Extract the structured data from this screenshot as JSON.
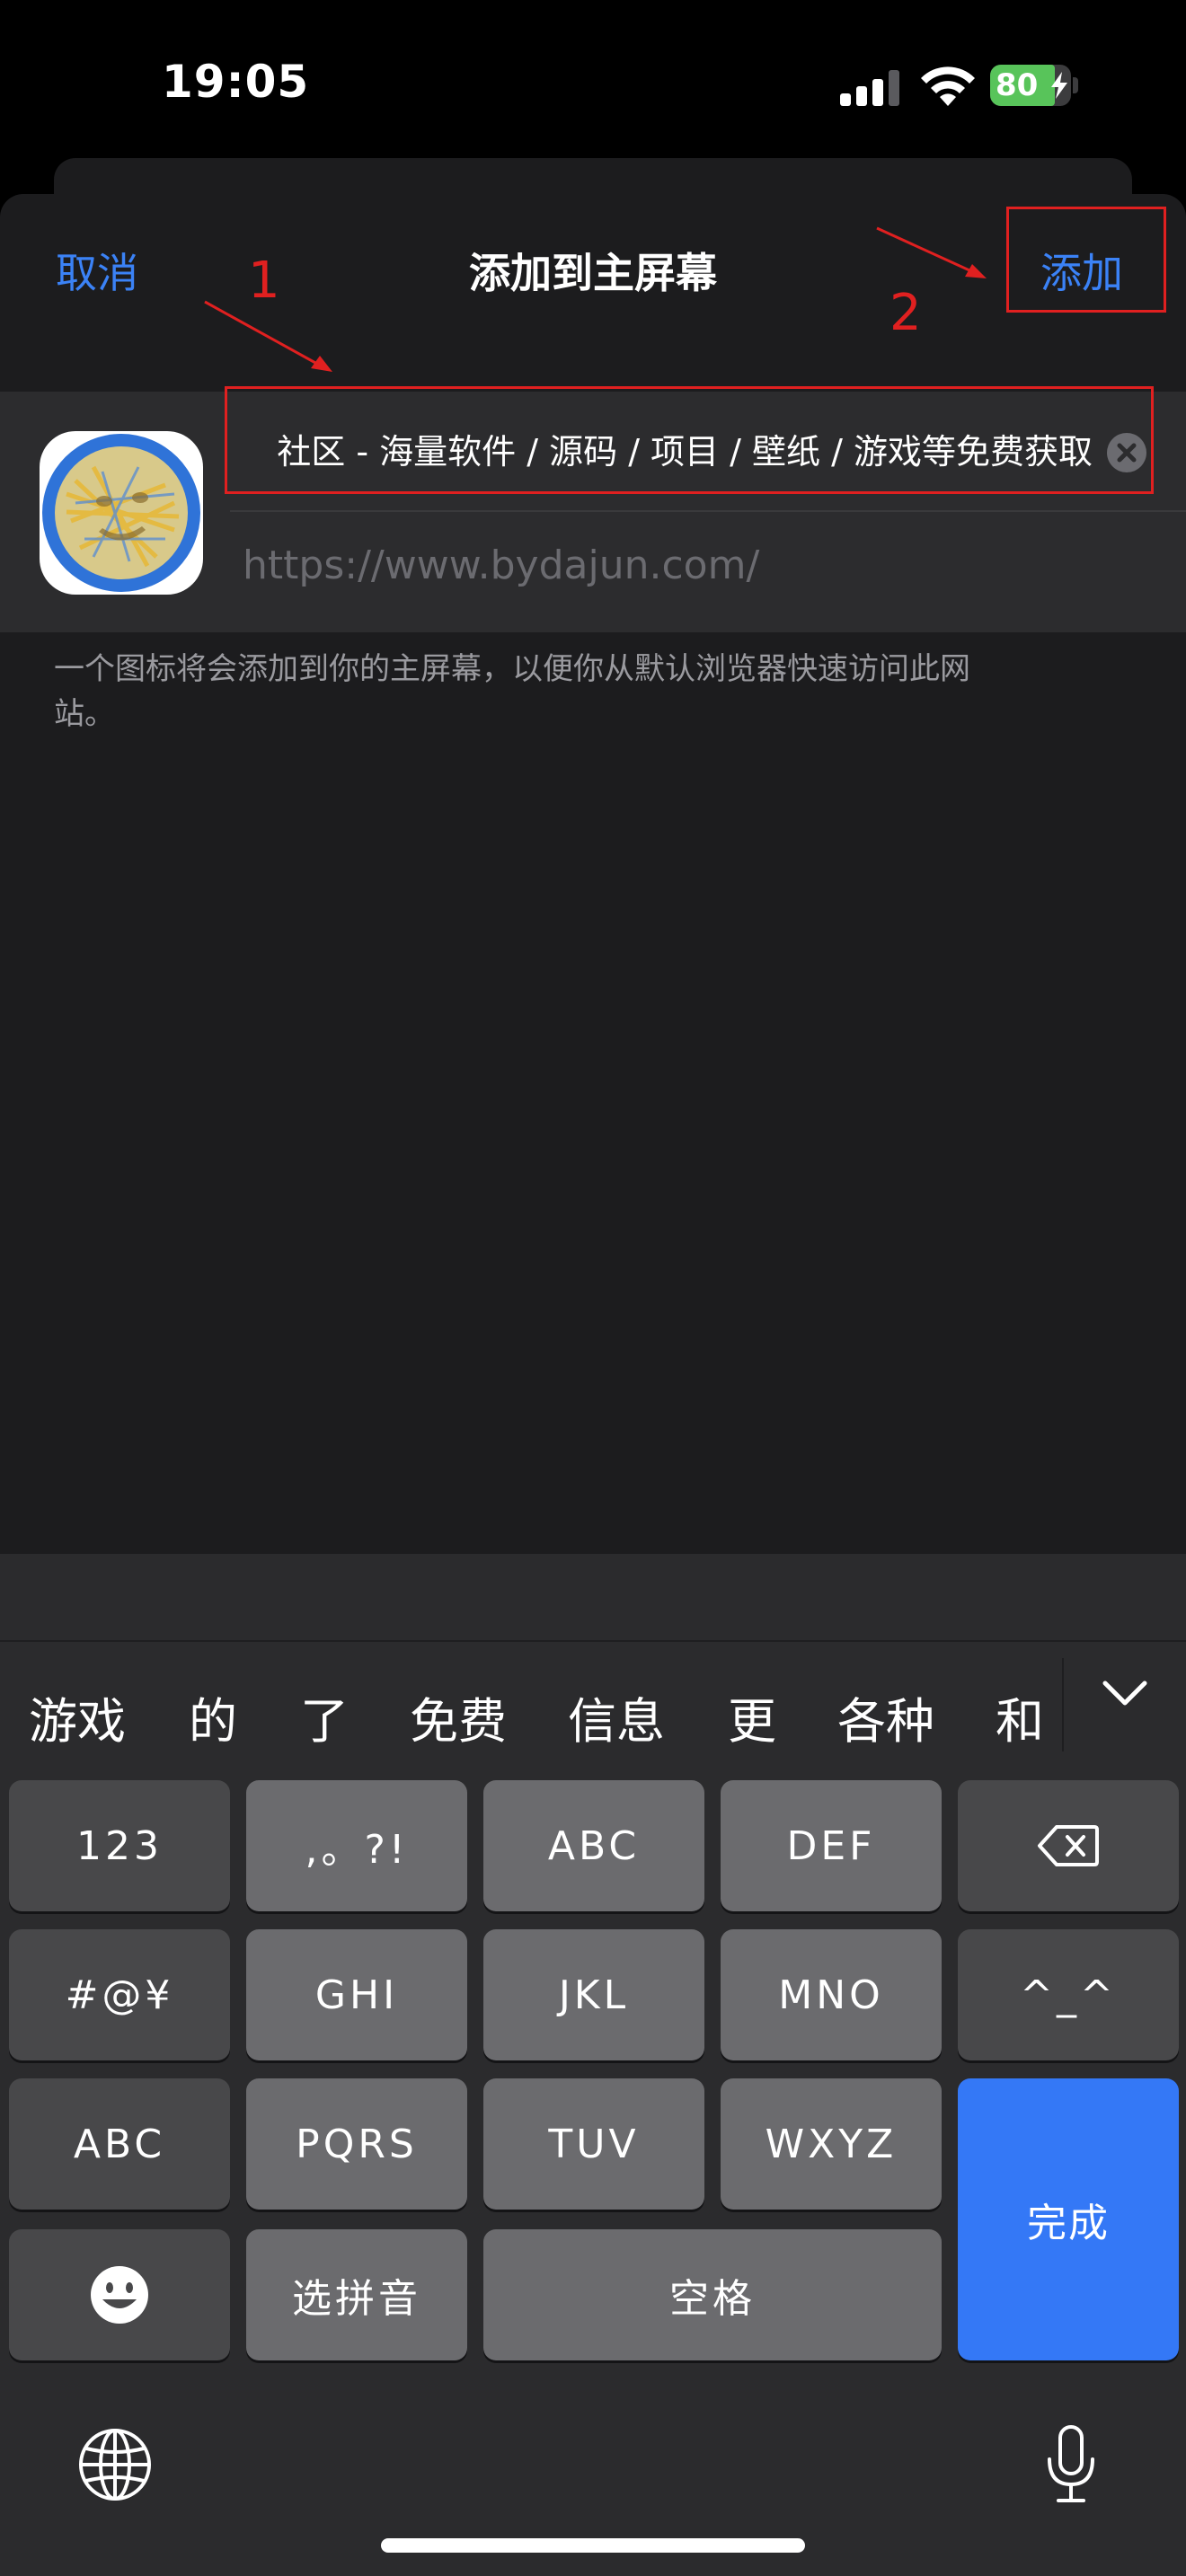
{
  "status_bar": {
    "time": "19:05",
    "battery_level": "80",
    "battery_fraction": 0.8
  },
  "nav": {
    "cancel_label": "取消",
    "title": "添加到主屏幕",
    "add_label": "添加"
  },
  "form": {
    "title_value": "社区 - 海量软件 / 源码 / 项目 / 壁纸 / 游戏等免费获取",
    "url_placeholder": "https://www.bydajun.com/",
    "hint": "一个图标将会添加到你的主屏幕，以便你从默认浏览器快速访问此网站。"
  },
  "annotations": {
    "step1": "1",
    "step2": "2"
  },
  "keyboard": {
    "candidates": [
      "游戏",
      "的",
      "了",
      "免费",
      "信息",
      "更",
      "各种",
      "和"
    ],
    "rows": [
      [
        "123",
        ",。?!",
        "ABC",
        "DEF"
      ],
      [
        "#@¥",
        "GHI",
        "JKL",
        "MNO",
        "^_^"
      ],
      [
        "ABC",
        "PQRS",
        "TUV",
        "WXYZ"
      ],
      [
        "选拼音",
        "空格"
      ]
    ],
    "done_label": "完成"
  },
  "colors": {
    "accent": "#3b82f6",
    "annotation": "#e02020",
    "sheet_bg": "#1c1c1e",
    "keyboard_bg": "#2b2b2d"
  }
}
